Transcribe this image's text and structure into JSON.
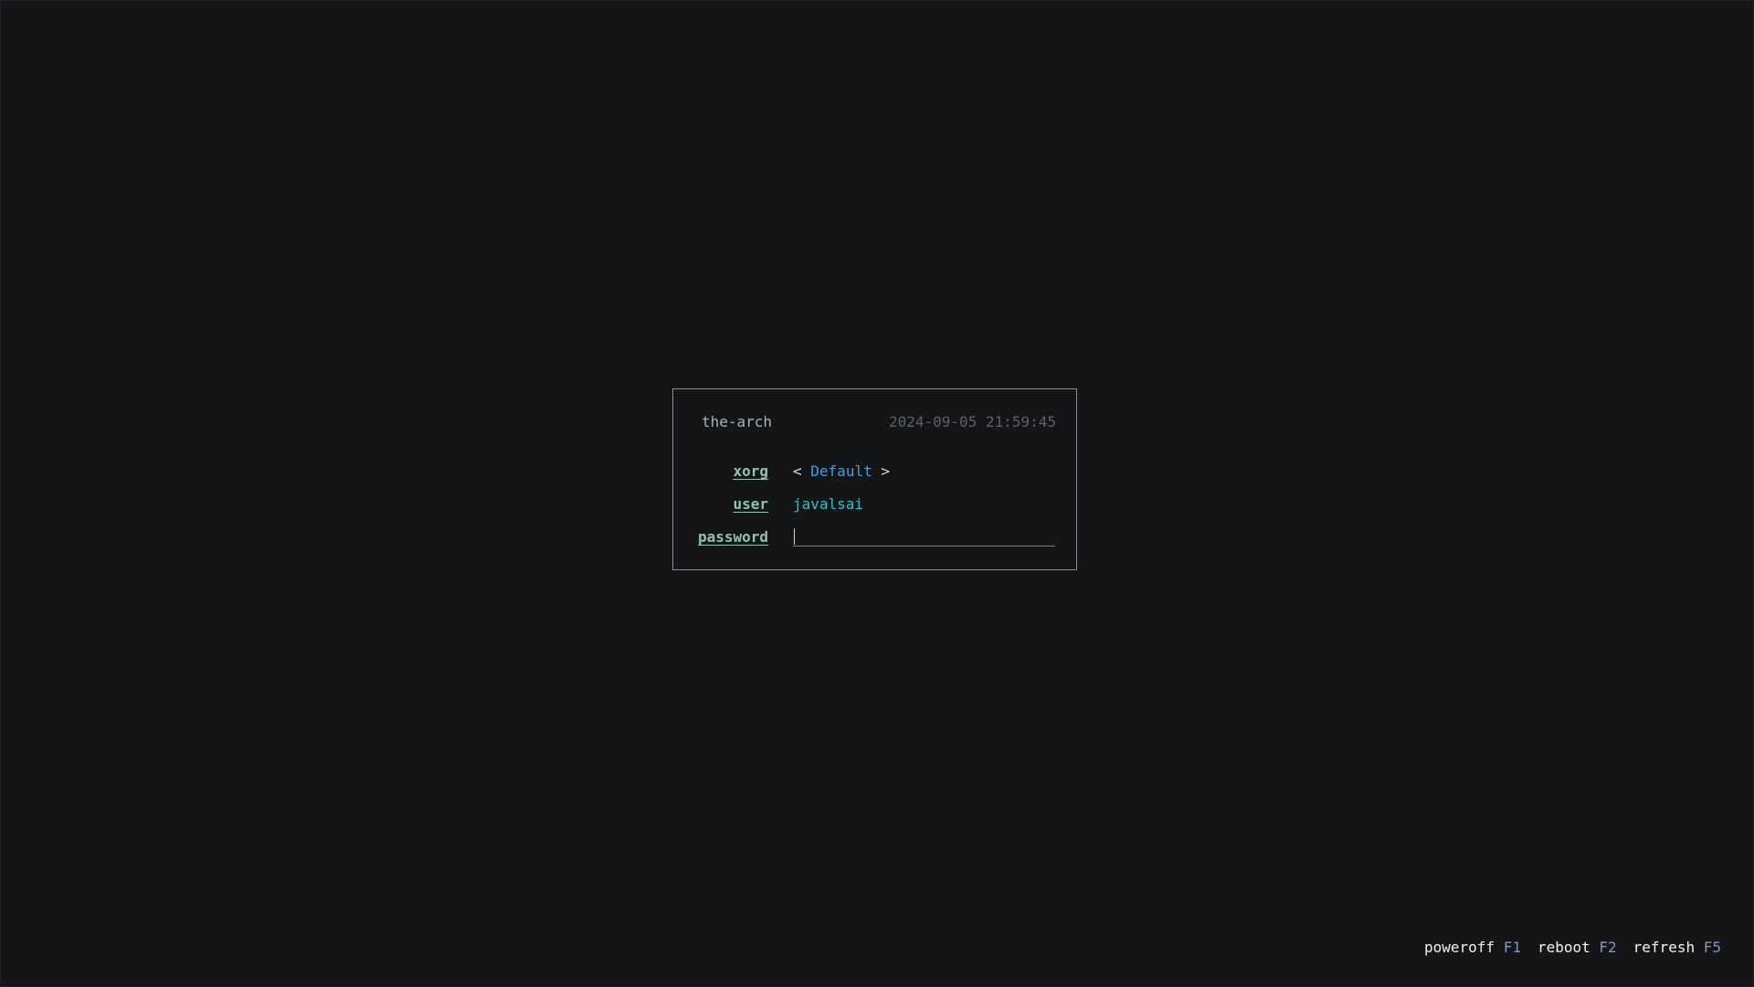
{
  "header": {
    "hostname": "the-arch",
    "datetime": "2024-09-05 21:59:45"
  },
  "form": {
    "session": {
      "label": "xorg",
      "arrow_left": "<",
      "value": "Default",
      "arrow_right": ">"
    },
    "user": {
      "label": "user",
      "value": "javalsai"
    },
    "password": {
      "label": "password",
      "value": ""
    }
  },
  "footer": {
    "actions": [
      {
        "label": "poweroff",
        "key": "F1"
      },
      {
        "label": "reboot",
        "key": "F2"
      },
      {
        "label": "refresh",
        "key": "F5"
      }
    ]
  },
  "colors": {
    "background": "#141517",
    "border": "#8a8d93",
    "label": "#8fc4b4",
    "user": "#27c4c9",
    "session": "#3ea0e6",
    "key": "#7d96cc"
  }
}
